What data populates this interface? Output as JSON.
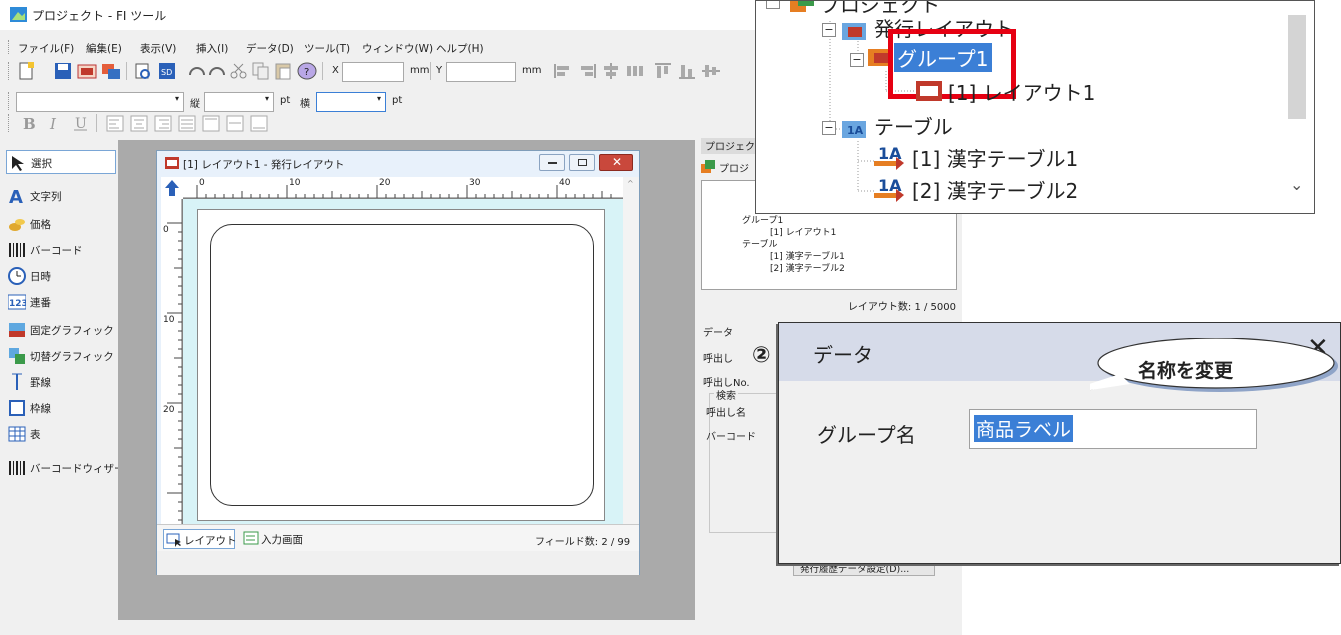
{
  "window": {
    "title": "プロジェクト - FI ツール"
  },
  "menu": [
    "ファイル(F)",
    "編集(E)",
    "表示(V)",
    "挿入(I)",
    "データ(D)",
    "ツール(T)",
    "ウィンドウ(W)",
    "ヘルプ(H)"
  ],
  "toolbar": {
    "x_label": "X",
    "y_label": "Y",
    "unit_mm": "mm",
    "tate_label": "縦",
    "yoko_label": "横",
    "unit_pt": "pt"
  },
  "tools": [
    "選択",
    "文字列",
    "価格",
    "バーコード",
    "日時",
    "連番",
    "固定グラフィック",
    "切替グラフィック",
    "罫線",
    "枠線",
    "表",
    "バーコードウィザード"
  ],
  "document": {
    "title": "[1] レイアウト1 - 発行レイアウト",
    "ruler_top": [
      "0",
      "10",
      "20",
      "30",
      "40"
    ],
    "ruler_left": [
      "0",
      "10",
      "20"
    ],
    "tab_layout": "レイアウト",
    "tab_input": "入力画面",
    "field_count": "フィールド数: 2 / 99"
  },
  "project_panel": {
    "header": "プロジェクト",
    "root_label": "プロジ",
    "tree": [
      "グループ1",
      "[1] レイアウト1",
      "テーブル",
      "[1] 漢字テーブル1",
      "[2] 漢字テーブル2"
    ],
    "layout_count": "レイアウト数: 1 / 5000"
  },
  "data_panel": {
    "header": "データ",
    "call_label": "呼出し",
    "call_no": "呼出しNo.",
    "search_group": "検索",
    "call_name": "呼出し名",
    "barcode": "バーコード",
    "history_button": "発行履歴データ設定(D)..."
  },
  "zoom_tree": {
    "nodes": [
      "プロジェクト",
      "発行レイアウト",
      "グループ1",
      "[1] レイアウト1",
      "テーブル",
      "[1] 漢字テーブル1",
      "[2] 漢字テーブル2"
    ]
  },
  "zoom_data": {
    "header": "データ",
    "group_label": "グループ名",
    "group_value": "商品ラベル",
    "step": "②",
    "callout": "名称を変更"
  },
  "colors": {
    "highlight_red": "#e60012",
    "selection_blue": "#3b7fd6",
    "page_bg": "#d8f3f7"
  }
}
